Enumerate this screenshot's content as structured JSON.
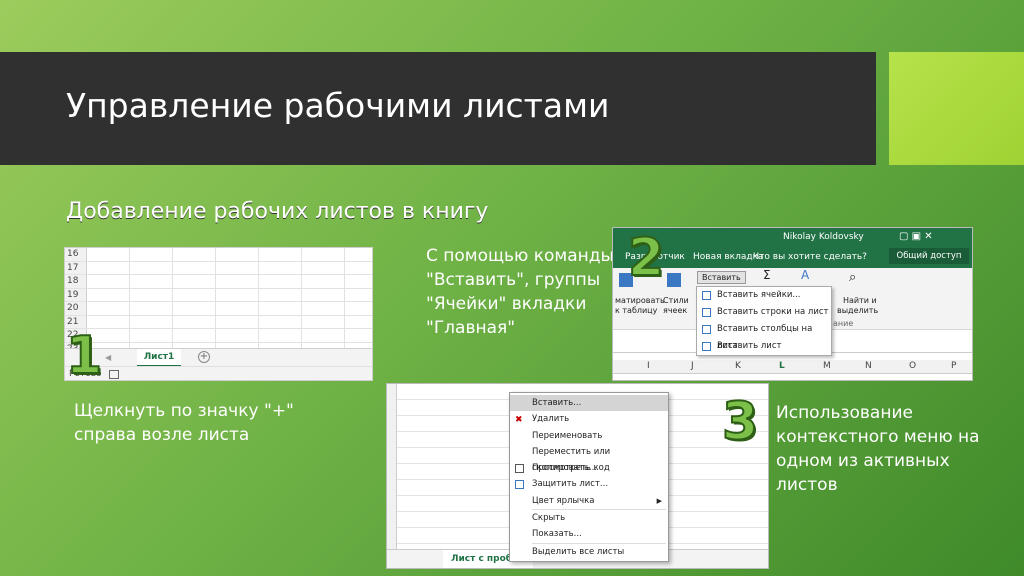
{
  "slide": {
    "title": "Управление рабочими листами",
    "subtitle": "Добавление рабочих листов в книгу",
    "step1_text": [
      "Щелкнуть по значку \"+\"",
      "справа возле листа"
    ],
    "step2_text": [
      "С помощью команды",
      "\"Вставить\", группы",
      "\"Ячейки\" вкладки",
      "\"Главная\""
    ],
    "step3_text": [
      "Использование",
      "контекстного меню на",
      "одном из активных",
      "листов"
    ],
    "numbers": [
      "1",
      "2",
      "3"
    ],
    "colors": {
      "title_bar": "#303030",
      "accent": "#a8d83c",
      "excel_green": "#217346"
    }
  },
  "sheet_shot": {
    "row_numbers": [
      "16",
      "17",
      "18",
      "19",
      "20",
      "21",
      "22",
      "23"
    ],
    "sheet_tab": "Лист1",
    "add_sheet_glyph": "+",
    "status": "Готово"
  },
  "ribbon_shot": {
    "tab_dev": "Разработчик",
    "tab_new": "Новая вкладка",
    "tell_me": "Что вы хотите сделать?",
    "user": "Nikolay Koldovsky",
    "share": "Общий доступ",
    "insert_button": "Вставить",
    "format_table": [
      "матировать",
      "к таблицу"
    ],
    "cell_styles": [
      "Стили",
      "ячеек"
    ],
    "find_select": [
      "Найти и",
      "выделить"
    ],
    "group_label": "ание",
    "menu": [
      "Вставить ячейки...",
      "Вставить строки на лист",
      "Вставить столбцы на лист",
      "Вставить лист"
    ],
    "columns": [
      "I",
      "J",
      "K",
      "L",
      "M",
      "N",
      "O",
      "P"
    ]
  },
  "context_shot": {
    "sheet_tab": "Лист с пробелом",
    "menu": [
      {
        "label": "Вставить...",
        "highlight": true
      },
      {
        "label": "Удалить"
      },
      {
        "label": "Переименовать"
      },
      {
        "label": "Переместить или скопировать..."
      },
      {
        "label": "Просмотреть код"
      },
      {
        "label": "Защитить лист..."
      },
      {
        "label": "Цвет ярлычка",
        "submenu": true
      },
      {
        "label": "Скрыть"
      },
      {
        "label": "Показать..."
      },
      {
        "label": "Выделить все листы"
      }
    ]
  }
}
